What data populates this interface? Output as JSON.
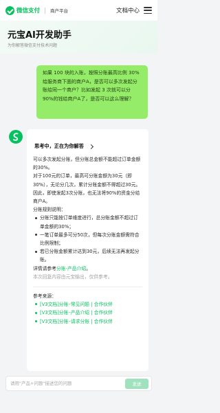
{
  "topbar": {
    "brand_name": "微信支付",
    "brand_sub": "商户平台",
    "doc_center": "文档中心"
  },
  "header": {
    "title": "元宝AI开发助手",
    "subtitle": "为你解答微信支付技术问题"
  },
  "user_message": "如果 100 块的入账，按照分账最高比例 30% 给服务商下面的商户A，是否可以多次发起分账给同一个商户？比如发起 3 次就可以分 90%的钱给商户A了，是否可以这么理解？",
  "bot": {
    "status": "思考中，正在为你解答",
    "paragraphs": [
      "可以多次发起分账，但分账总金额不能超过订单金额的30%。",
      "对于100元的订单，最高可分账金额为30元（即30%），无论分几次，累计分账金额不得超过30元。因此，即使发起3次分账，也无法将90%的资金分给商户A。",
      "分账规则说明："
    ],
    "rules": [
      "分账只能按订单维度进行，总分账金额不超过订单金额的30%；",
      "一笔订单最多可分50次，但每次分账金额需符合比例限制；",
      "若已分账金额累计达到30元，后续无法再发起分账。"
    ],
    "detail_prefix": "详情请参考",
    "detail_link": "分账-产品介绍",
    "detail_suffix": "。",
    "disclaimer": "本次回复内容由元宝输出，仅供参考。",
    "refs_title": "参考来源：",
    "refs": [
      "[V3文档]分账–常见问题 | 合作伙伴",
      "[V3文档]分账–产品介绍 | 合作伙伴",
      "[V3文档]分账–请求分账 | 合作伙伴"
    ]
  },
  "input": {
    "placeholder": "请用\"产品+问题\"描述您的问题",
    "value": "",
    "send_label": "发送"
  },
  "colors": {
    "brand_green": "#07c160",
    "user_bubble": "#95ec69",
    "send_button_disabled": "#9fe2bd"
  }
}
